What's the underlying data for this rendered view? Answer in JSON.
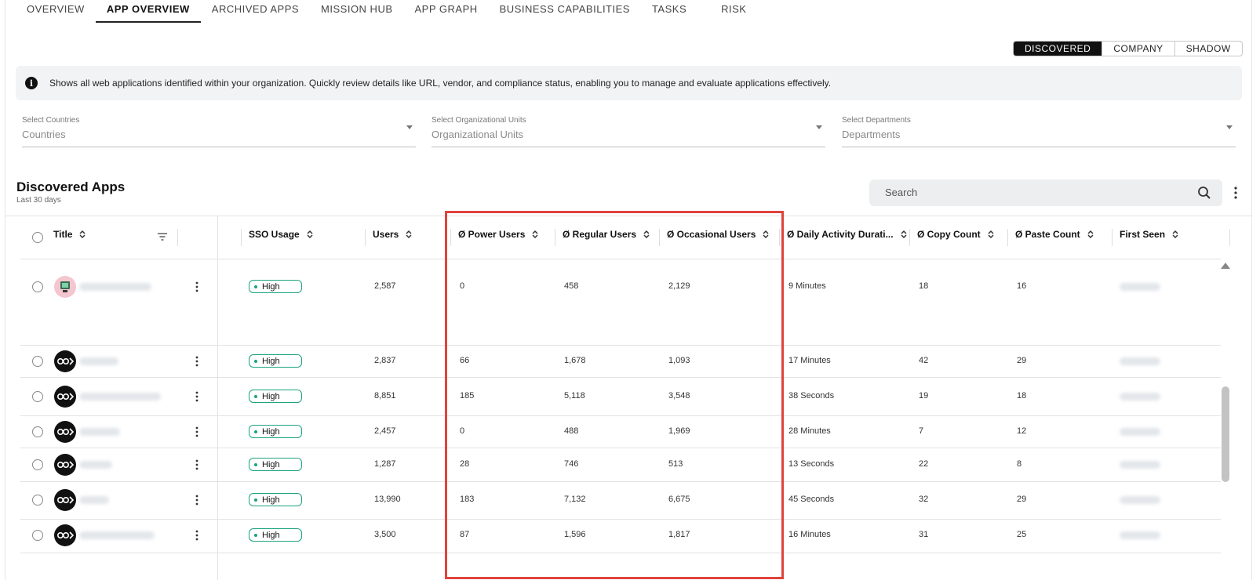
{
  "nav": {
    "tabs": [
      "OVERVIEW",
      "APP OVERVIEW",
      "ARCHIVED APPS",
      "MISSION HUB",
      "APP GRAPH",
      "BUSINESS CAPABILITIES",
      "TASKS",
      "RISK"
    ]
  },
  "view_toggle": [
    "DISCOVERED",
    "COMPANY",
    "SHADOW"
  ],
  "info": {
    "icon": "info-icon",
    "text": "Shows all web applications identified within your organization. Quickly review details like URL, vendor, and compliance status, enabling you to manage and evaluate applications effectively."
  },
  "filters": {
    "countries": {
      "label": "Select Countries",
      "placeholder": "Countries"
    },
    "org_units": {
      "label": "Select Organizational Units",
      "placeholder": "Organizational Units"
    },
    "departments": {
      "label": "Select Departments",
      "placeholder": "Departments"
    }
  },
  "section": {
    "title": "Discovered Apps",
    "subtitle": "Last 30 days"
  },
  "search": {
    "placeholder": "Search"
  },
  "columns": {
    "title": "Title",
    "sso": "SSO Usage",
    "users": "Users",
    "power": "Ø Power Users",
    "regular": "Ø Regular Users",
    "occasional": "Ø Occasional Users",
    "daily": "Ø Daily Activity Durati...",
    "copy": "Ø Copy Count",
    "paste": "Ø Paste Count",
    "first_seen": "First Seen"
  },
  "rows": [
    {
      "sso": "High",
      "users": "2,587",
      "power": "0",
      "regular": "458",
      "occasional": "2,129",
      "daily": "9 Minutes",
      "copy": "18",
      "paste": "16"
    },
    {
      "sso": "High",
      "users": "2,837",
      "power": "66",
      "regular": "1,678",
      "occasional": "1,093",
      "daily": "17 Minutes",
      "copy": "42",
      "paste": "29"
    },
    {
      "sso": "High",
      "users": "8,851",
      "power": "185",
      "regular": "5,118",
      "occasional": "3,548",
      "daily": "38 Seconds",
      "copy": "19",
      "paste": "18"
    },
    {
      "sso": "High",
      "users": "2,457",
      "power": "0",
      "regular": "488",
      "occasional": "1,969",
      "daily": "28 Minutes",
      "copy": "7",
      "paste": "12"
    },
    {
      "sso": "High",
      "users": "1,287",
      "power": "28",
      "regular": "746",
      "occasional": "513",
      "daily": "13 Seconds",
      "copy": "22",
      "paste": "8"
    },
    {
      "sso": "High",
      "users": "13,990",
      "power": "183",
      "regular": "7,132",
      "occasional": "6,675",
      "daily": "45 Seconds",
      "copy": "32",
      "paste": "29"
    },
    {
      "sso": "High",
      "users": "3,500",
      "power": "87",
      "regular": "1,596",
      "occasional": "1,817",
      "daily": "16 Minutes",
      "copy": "31",
      "paste": "25"
    }
  ],
  "colors": {
    "badge_border": "#1aa37e",
    "highlight": "#e0433c",
    "active_toggle": "#111111"
  }
}
